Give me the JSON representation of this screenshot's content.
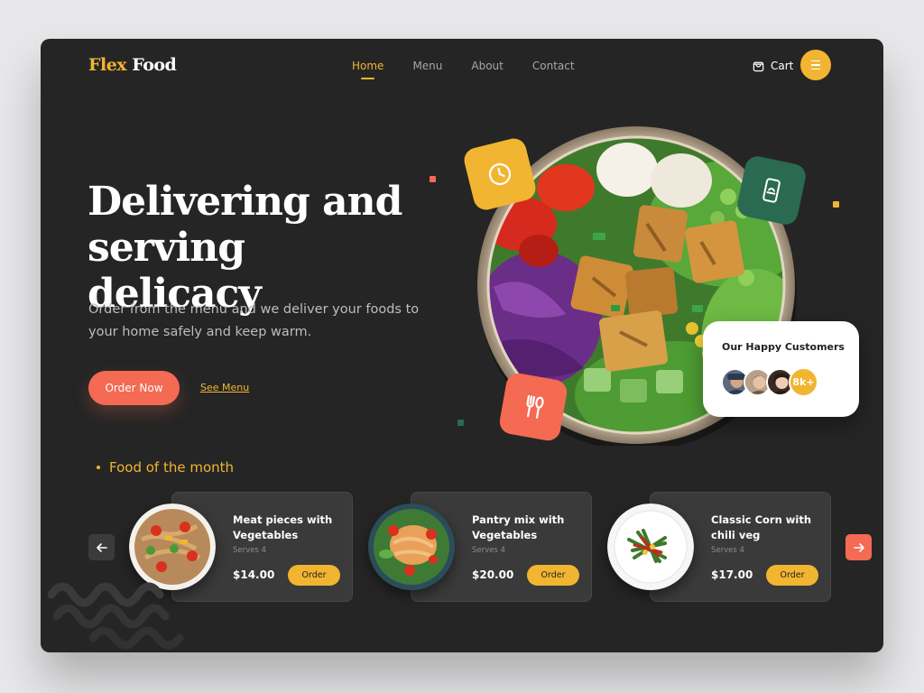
{
  "brand": {
    "part1": "Flex",
    "part2": "Food",
    "accent": "#f2b531",
    "coral": "#f46a52",
    "teal": "#2a6a51"
  },
  "nav": {
    "items": [
      {
        "label": "Home",
        "active": true
      },
      {
        "label": "Menu",
        "active": false
      },
      {
        "label": "About",
        "active": false
      },
      {
        "label": "Contact",
        "active": false
      }
    ],
    "cart_label": "Cart",
    "cart_icon": "shopping-bag-icon",
    "menu_icon": "hamburger-menu-icon"
  },
  "hero": {
    "title_line1": "Delivering and",
    "title_line2": "serving delicacy",
    "subtitle": "Order from the menu and we deliver your foods to your home safely and keep warm.",
    "order_button": "Order Now",
    "see_menu_link": "See Menu"
  },
  "badges": {
    "clock_icon": "clock-icon",
    "phone_icon": "mobile-order-icon",
    "cutlery_icon": "fork-spoon-icon"
  },
  "customers": {
    "title": "Our Happy Customers",
    "count": "8k+"
  },
  "food_of_month": {
    "heading": "Food of the month",
    "prev_icon": "arrow-left-icon",
    "next_icon": "arrow-right-icon",
    "items": [
      {
        "title": "Meat pieces with Vegetables",
        "serves": "Serves 4",
        "price": "$14.00",
        "order_label": "Order"
      },
      {
        "title": "Pantry mix with Vegetables",
        "serves": "Serves 4",
        "price": "$20.00",
        "order_label": "Order"
      },
      {
        "title": "Classic Corn with chili veg",
        "serves": "Serves 4",
        "price": "$17.00",
        "order_label": "Order"
      }
    ]
  }
}
